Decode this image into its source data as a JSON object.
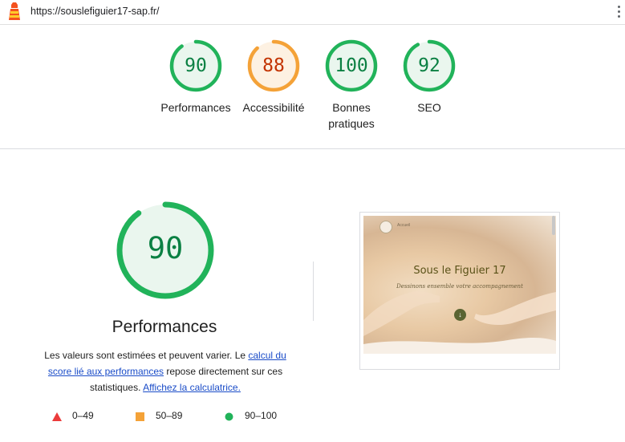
{
  "app": {
    "url": "https://souslefiguier17-sap.fr/"
  },
  "categories": [
    {
      "key": "performance",
      "label": "Performances",
      "score": 90,
      "status": "pass"
    },
    {
      "key": "accessibility",
      "label": "Accessibilité",
      "score": 88,
      "status": "average"
    },
    {
      "key": "best-practices",
      "label": "Bonnes pratiques",
      "label_line1": "Bonnes",
      "label_line2": "pratiques",
      "score": 100,
      "status": "pass"
    },
    {
      "key": "seo",
      "label": "SEO",
      "score": 92,
      "status": "pass"
    }
  ],
  "main": {
    "score": 90,
    "title": "Performances",
    "desc_part1": "Les valeurs sont estimées et peuvent varier. Le ",
    "desc_link1": "calcul du score lié aux performances",
    "desc_part2": " repose directement sur ces statistiques. ",
    "desc_link2": "Affichez la calculatrice."
  },
  "legend": [
    {
      "range": "0–49",
      "shape": "triangle",
      "color": "#eb3b3b"
    },
    {
      "range": "50–89",
      "shape": "square",
      "color": "#f4a238"
    },
    {
      "range": "90–100",
      "shape": "circle",
      "color": "#21b35a"
    }
  ],
  "screenshot": {
    "nav_label": "Accueil",
    "title": "Sous le Figuier 17",
    "subtitle": "Dessinons ensemble votre accompagnement"
  },
  "colors": {
    "pass": "#21b35a",
    "pass_fill": "#eaf6ee",
    "pass_text": "#0b8043",
    "average": "#f4a238",
    "average_fill": "#fdf1e2",
    "average_text": "#c33300"
  }
}
